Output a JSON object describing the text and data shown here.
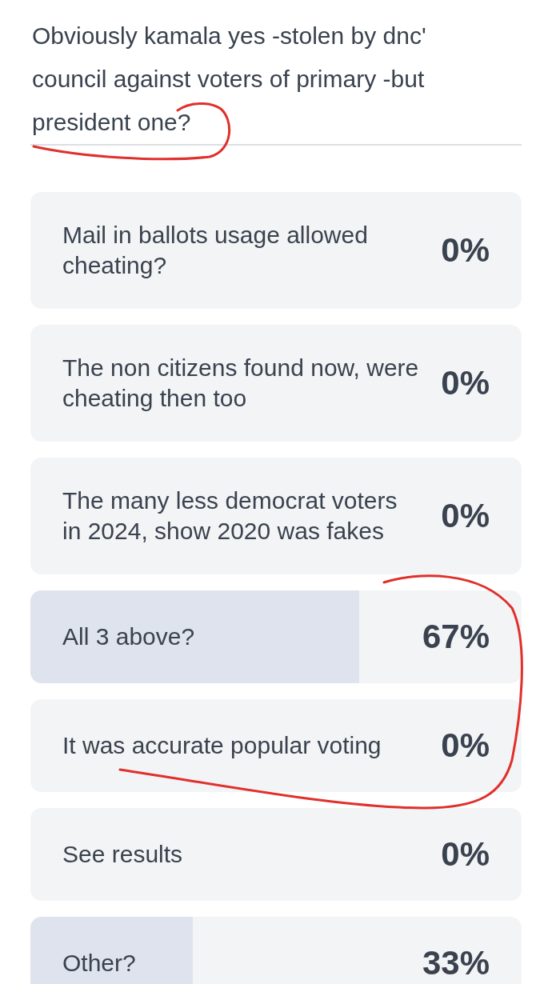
{
  "question": "Obviously kamala yes -stolen by dnc' council against voters of primary -but president one?",
  "options": [
    {
      "label": "Mail in ballots usage allowed cheating?",
      "percent": "0%"
    },
    {
      "label": "The non citizens found now, were cheating then too",
      "percent": "0%"
    },
    {
      "label": "The many less democrat voters in 2024, show 2020 was fakes",
      "percent": "0%"
    },
    {
      "label": "All 3 above?",
      "percent": "67%",
      "level": 0.67
    },
    {
      "label": "It was accurate popular voting",
      "percent": "0%"
    },
    {
      "label": "See results",
      "percent": "0%"
    },
    {
      "label": "Other?",
      "percent": "33%",
      "level": 0.33
    }
  ]
}
